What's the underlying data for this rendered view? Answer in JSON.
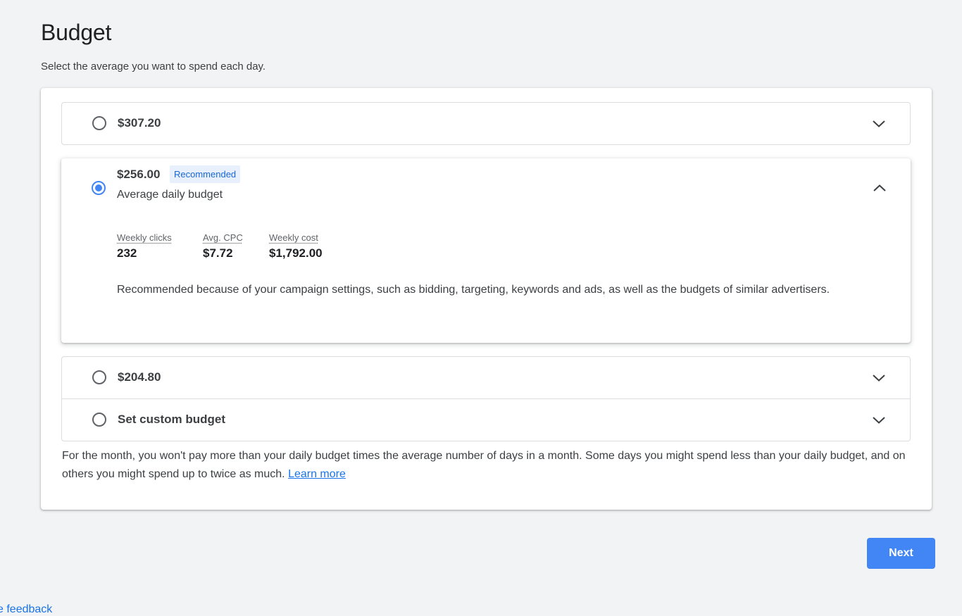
{
  "header": {
    "title": "Budget",
    "subtitle": "Select the average you want to spend each day."
  },
  "options": [
    {
      "label": "$307.20",
      "selected": false,
      "expanded": false
    },
    {
      "price": "$256.00",
      "badge": "Recommended",
      "sublabel": "Average daily budget",
      "selected": true,
      "expanded": true,
      "metrics": [
        {
          "label": "Weekly clicks",
          "value": "232"
        },
        {
          "label": "Avg. CPC",
          "value": "$7.72"
        },
        {
          "label": "Weekly cost",
          "value": "$1,792.00"
        }
      ],
      "description": "Recommended because of your campaign settings, such as bidding, targeting, keywords and ads, as well as the budgets of similar advertisers."
    },
    {
      "label": "$204.80",
      "selected": false,
      "expanded": false
    },
    {
      "label": "Set custom budget",
      "selected": false,
      "expanded": false
    }
  ],
  "footnote": {
    "text": "For the month, you won't pay more than your daily budget times the average number of days in a month. Some days you might spend less than your daily budget, and on others you might spend up to twice as much. ",
    "link": "Learn more"
  },
  "actions": {
    "next_label": "Next"
  },
  "feedback": {
    "label": "ve feedback"
  },
  "colors": {
    "accent": "#4285f4",
    "link": "#1a73e8",
    "badge_bg": "#e8f0fe",
    "page_bg": "#f1f3f4"
  },
  "icons": {
    "expand": "chevron-down-icon",
    "collapse": "chevron-up-icon"
  }
}
